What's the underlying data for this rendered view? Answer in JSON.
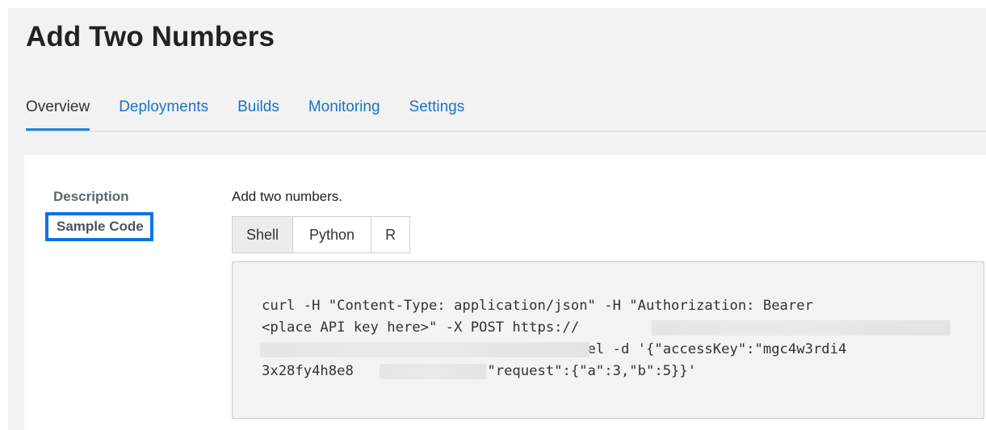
{
  "page": {
    "title": "Add Two Numbers"
  },
  "tabs": [
    {
      "label": "Overview",
      "active": true
    },
    {
      "label": "Deployments",
      "active": false
    },
    {
      "label": "Builds",
      "active": false
    },
    {
      "label": "Monitoring",
      "active": false
    },
    {
      "label": "Settings",
      "active": false
    }
  ],
  "sidebar": {
    "description_label": "Description",
    "sample_code_label": "Sample Code",
    "selected": "Sample Code"
  },
  "content": {
    "description": "Add two numbers.",
    "language_tabs": [
      {
        "label": "Shell",
        "active": true
      },
      {
        "label": "Python",
        "active": false
      },
      {
        "label": "R",
        "active": false
      }
    ],
    "code_lines": [
      "curl -H \"Content-Type: application/json\" -H \"Authorization: Bearer",
      "<place API key here>\" -X POST https://",
      "                                   /model -d '{\"accessKey\":\"mgc4w3rdi4",
      "3x28fy4h8e8              \",\"request\":{\"a\":3,\"b\":5}}'"
    ]
  },
  "colors": {
    "link": "#1a73c8",
    "active_underline": "#1e88e5",
    "highlight_border": "#0a73e6"
  }
}
